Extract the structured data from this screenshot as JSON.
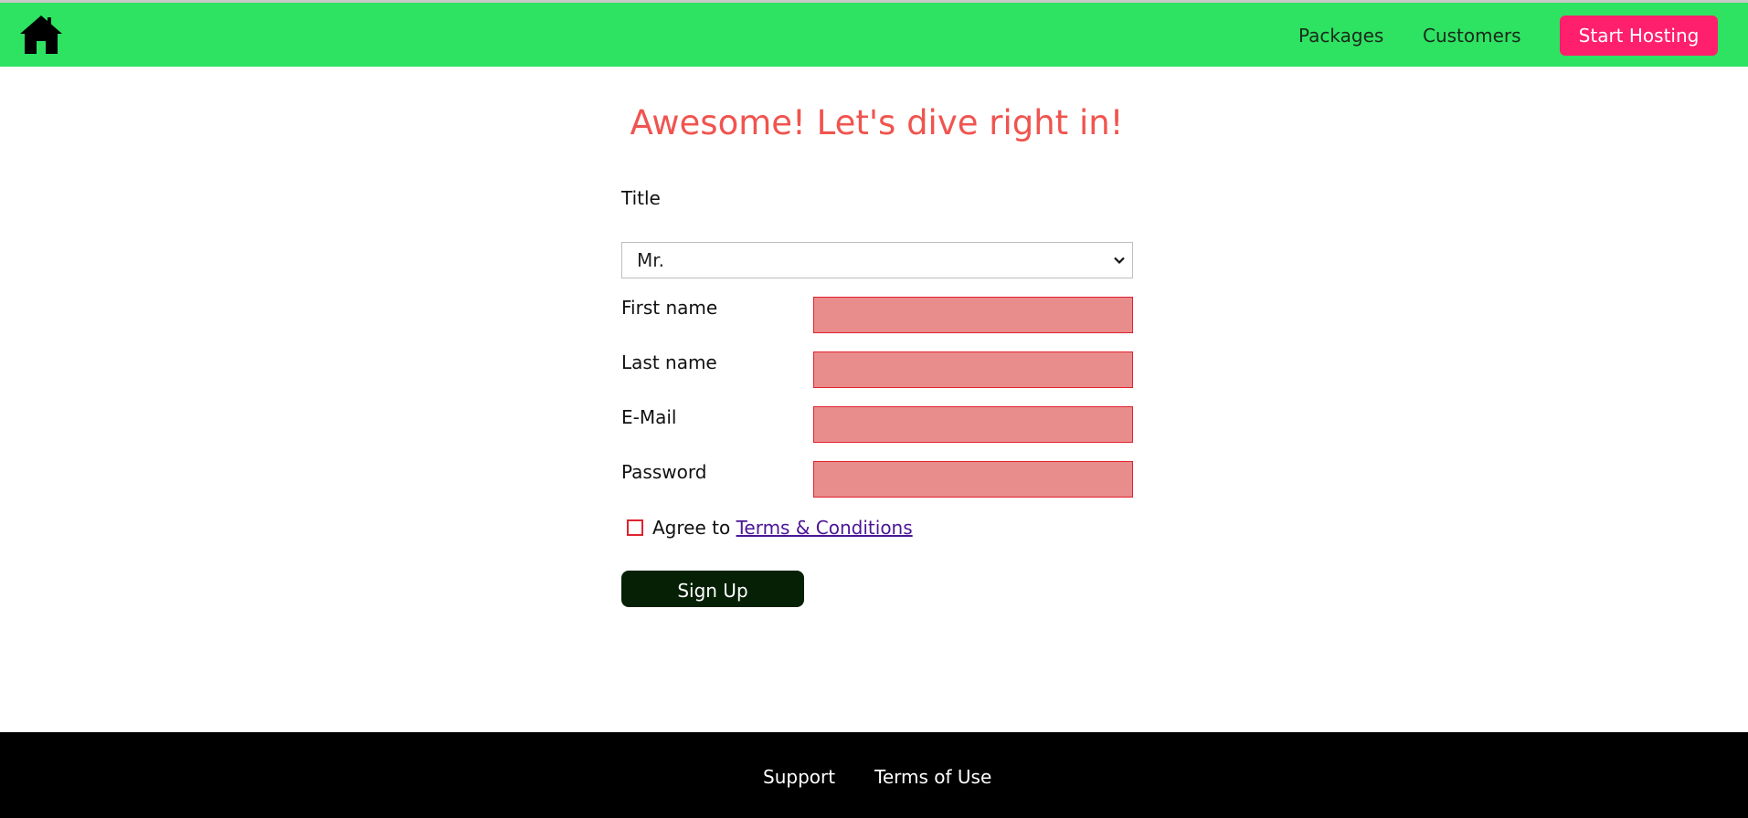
{
  "header": {
    "home_icon": "home-icon",
    "nav": {
      "packages": "Packages",
      "customers": "Customers"
    },
    "cta_label": "Start Hosting"
  },
  "colors": {
    "header_bg": "#2ee262",
    "cta_bg": "#ff1f6c",
    "title": "#f0544f",
    "invalid_field_bg": "#e98c8c",
    "invalid_field_border": "#e0232e",
    "signup_bg": "#062006",
    "footer_bg": "#000000"
  },
  "main": {
    "heading": "Awesome! Let's dive right in!",
    "form": {
      "title_label": "Title",
      "title_value": "Mr.",
      "first_name_label": "First name",
      "last_name_label": "Last name",
      "email_label": "E-Mail",
      "password_label": "Password",
      "agree_prefix": "Agree to",
      "terms_link": "Terms & Conditions",
      "submit_label": "Sign Up"
    }
  },
  "footer": {
    "support": "Support",
    "terms_of_use": "Terms of Use"
  }
}
